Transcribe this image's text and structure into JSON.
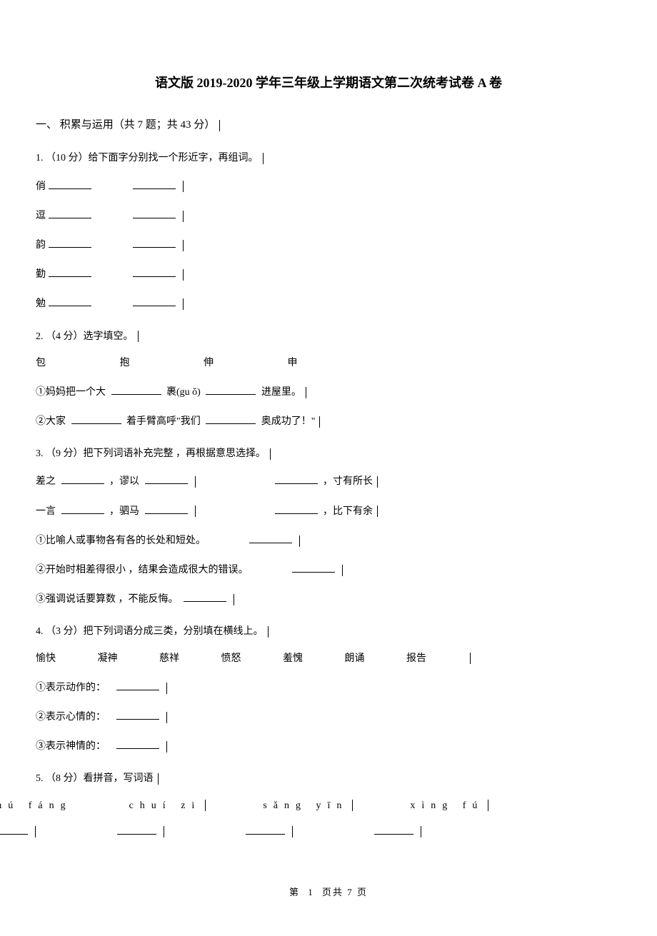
{
  "title": "语文版 2019-2020 学年三年级上学期语文第二次统考试卷 A 卷",
  "section1": {
    "header": "一、 积累与运用（共 7 题；共 43 分）"
  },
  "q1": {
    "prompt": "1. （10 分）给下面字分别找一个形近字，再组词。",
    "chars": [
      "俏",
      "逗",
      "韵",
      "勤",
      "勉"
    ]
  },
  "q2": {
    "prompt": "2. （4 分）选字填空。",
    "options": {
      "a": "包",
      "b": "抱",
      "c": "伸",
      "d": "申"
    },
    "line1_a": "①妈妈把一个大",
    "line1_b": "裹(gu ǒ)",
    "line1_c": "进屋里。",
    "line2_a": "②大家",
    "line2_b": "着手臂高呼\"我们",
    "line2_c": "奥成功了！\""
  },
  "q3": {
    "prompt": "3. （9 分）把下列词语补充完整 ，再根据意思选择。",
    "line1_a": "差之",
    "line1_b": "，谬以",
    "line1_c": "，寸有所长",
    "line2_a": "一言",
    "line2_b": "，驷马",
    "line2_c": "，比下有余",
    "desc1": "①比喻人或事物各有各的长处和短处。",
    "desc2": "②开始时相差得很小 ，结果会造成很大的错误。",
    "desc3": "③强调说话要算数 ，不能反悔。"
  },
  "q4": {
    "prompt": "4. （3 分）把下列词语分成三类，分别填在横线上。",
    "words": [
      "愉快",
      "凝神",
      "慈祥",
      "愤怒",
      "羞愧",
      "朗诵",
      "报告"
    ],
    "l1": "①表示动作的：",
    "l2": "②表示心情的：",
    "l3": "③表示神情的："
  },
  "q5": {
    "prompt": "5. （8 分）看拼音，写词语",
    "py": [
      "chú fáng",
      "chuí zi",
      "sǎng yīn",
      "xìng fú"
    ]
  },
  "footer": {
    "pre": "第",
    "num": "1",
    "post": "页共 7 页"
  }
}
